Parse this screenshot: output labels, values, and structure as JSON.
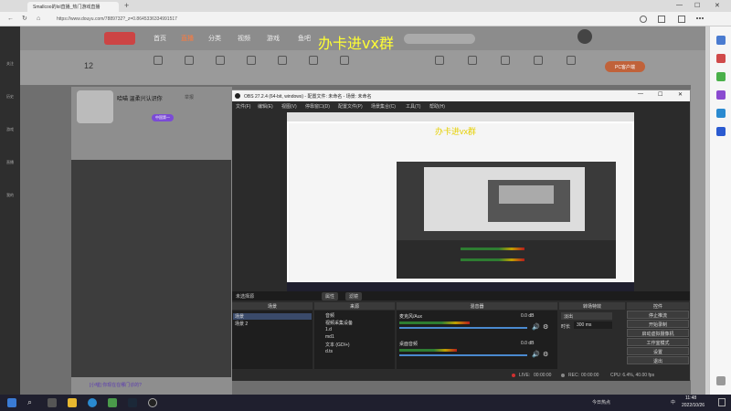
{
  "browser": {
    "tab_title": "Smallcoo的lol直播_热门游戏直播",
    "url": "https://www.douyu.com/7889732?_z=0.8645336334991517",
    "back_glyph": "←",
    "refresh_glyph": "↻",
    "home_glyph": "⌂",
    "new_tab_glyph": "+",
    "min_glyph": "—",
    "max_glyph": "☐",
    "close_glyph": "✕"
  },
  "site": {
    "nav": [
      "首页",
      "直播",
      "分类",
      "视频",
      "游戏",
      "鱼吧"
    ],
    "sub_count": "12",
    "sub_items": [
      "",
      "",
      "",
      "",
      "",
      "",
      "",
      "",
      "",
      "",
      "",
      "",
      "",
      "",
      ""
    ],
    "pc_client": "PC客户端",
    "streamer_name": "哈喵 温柔兴认识你",
    "report": "举报",
    "tag": "中国第一",
    "bottom_text": "[小喵] 你现在在哪门诊的?",
    "left_items": [
      "关注",
      "历史",
      "游戏",
      "直播",
      "我的"
    ]
  },
  "overlay_text": "办卡进vx群",
  "obs": {
    "title": "OBS 27.2.4 (64-bit, windows) - 配置文件: 未命名 - 场景: 未命名",
    "menu": [
      "文件(F)",
      "编辑(E)",
      "视图(V)",
      "停靠窗口(D)",
      "配置文件(P)",
      "场景集合(C)",
      "工具(T)",
      "帮助(H)"
    ],
    "no_source": "未选择源",
    "props_btn": "属性",
    "filters_btn": "滤镜",
    "dock_headers": [
      "场景",
      "来源",
      "混音器",
      "转场特效",
      "控件"
    ],
    "scenes": [
      "场景",
      "场景 2"
    ],
    "sources": [
      "音频",
      "视频采集设备",
      "1.d",
      "md1",
      "文本 (GDI+)",
      "d.ts"
    ],
    "mixer": [
      {
        "name": "麦克风/Aux",
        "db": "0.0 dB",
        "level": 0.55
      },
      {
        "name": "桌面音频",
        "db": "0.0 dB",
        "level": 0.45
      }
    ],
    "transition": {
      "type": "淡出",
      "duration_label": "时长",
      "duration": "300 ms"
    },
    "controls": [
      "停止推流",
      "开始录制",
      "启动虚拟摄像机",
      "工作室模式",
      "设置",
      "退出"
    ],
    "status": {
      "live_label": "LIVE:",
      "live_time": "00:00:00",
      "rec_label": "REC:",
      "rec_time": "00:00:00",
      "cpu": "CPU: 6.4%, 40.00 fps"
    }
  },
  "taskbar": {
    "weather": "今日热点",
    "time": "11:48",
    "date": "2022/10/26",
    "lang": "中"
  },
  "colors": {
    "obs_bg": "#2b2b2b",
    "overlay": "#ffff33",
    "accent_purple": "#7b4bd6"
  }
}
